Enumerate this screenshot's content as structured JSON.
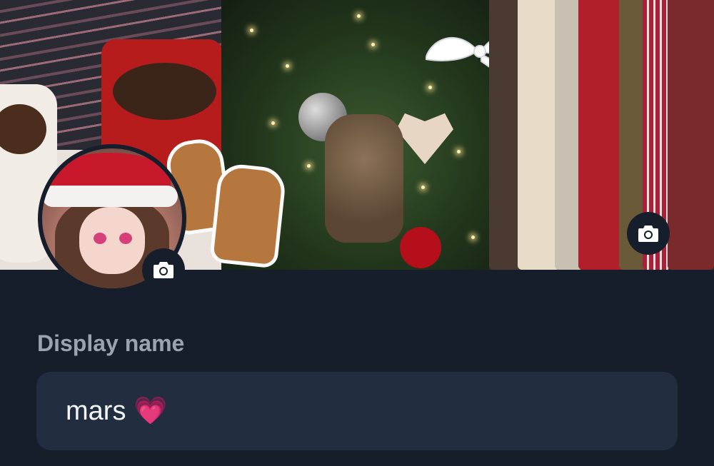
{
  "cover": {
    "image_alt": "Christmas collage cover photo",
    "change_button_icon": "camera-icon"
  },
  "avatar": {
    "image_alt": "Anime character with Santa hat",
    "change_button_icon": "camera-icon"
  },
  "display_name": {
    "label": "Display name",
    "value": "mars 💗"
  },
  "colors": {
    "background": "#161e2b",
    "input_background": "#222d40",
    "label": "#9aa3b2",
    "text": "#f3f5f8"
  }
}
